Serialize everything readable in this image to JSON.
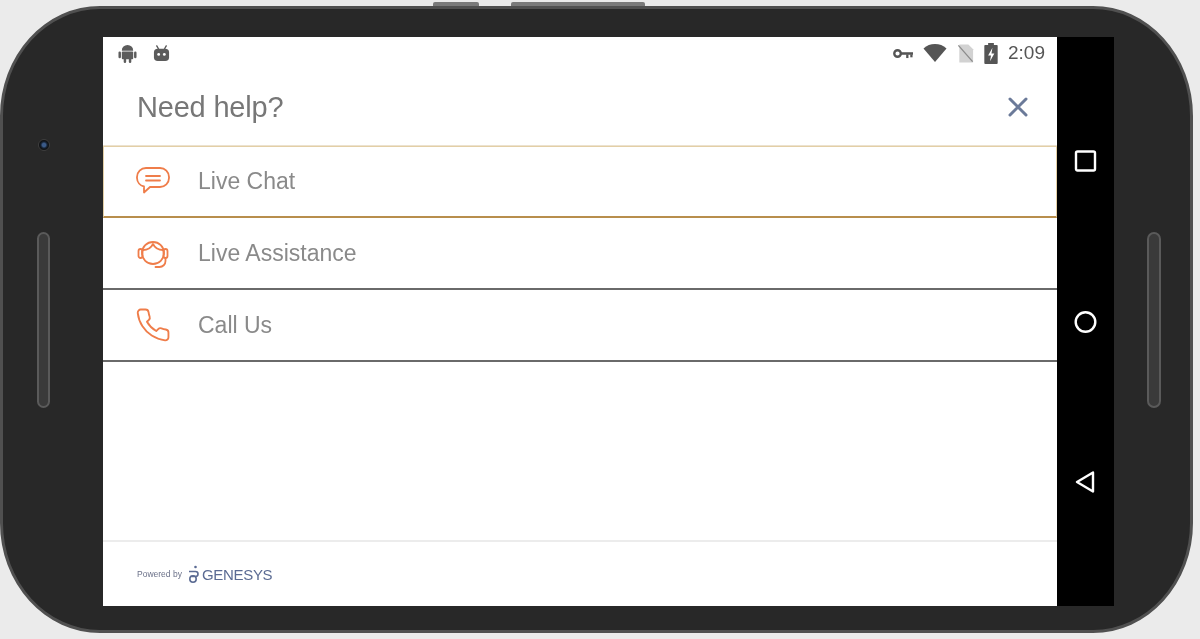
{
  "status_bar": {
    "time": "2:09"
  },
  "header": {
    "title": "Need help?"
  },
  "options": [
    {
      "kind": "chat",
      "label": "Live Chat",
      "selected": true
    },
    {
      "kind": "agent",
      "label": "Live Assistance",
      "selected": false
    },
    {
      "kind": "phone",
      "label": "Call Us",
      "selected": false
    }
  ],
  "footer": {
    "powered_by": "Powered by",
    "brand": "GENESYS"
  }
}
